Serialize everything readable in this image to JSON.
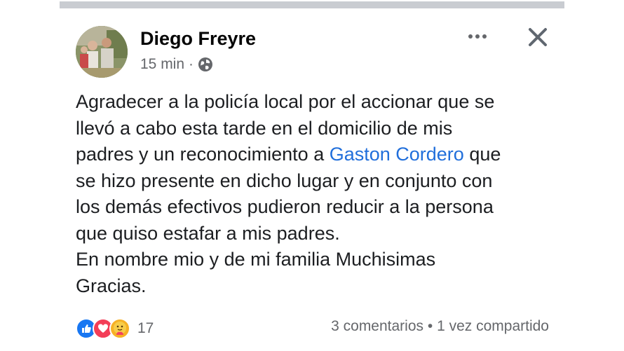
{
  "post": {
    "author": "Diego Freyre",
    "time": "15 min",
    "separator": "·",
    "privacy_icon": "globe-icon",
    "more_icon": "more-options-icon",
    "close_icon": "close-icon",
    "text": {
      "line1": "Agradecer a la policía local por el accionar que se",
      "line2": "llevó a cabo esta tarde en el domicilio de mis",
      "line3_before": "padres y un reconocimiento a ",
      "line3_mention": "Gaston Cordero",
      "line3_after": " que",
      "line4": "se hizo presente en dicho lugar y en conjunto con",
      "line5": "los demás efectivos pudieron reducir a la persona",
      "line6": "que quiso estafar a mis padres.",
      "line7": "En nombre mio y de mi familia Muchisimas",
      "line8": "Gracias."
    },
    "reactions": {
      "icons": [
        "like-icon",
        "love-icon",
        "care-icon"
      ],
      "count": "17"
    },
    "comments_label": "3 comentarios",
    "shares_separator": "•",
    "shares_label": "1 vez compartido"
  },
  "colors": {
    "mention": "#216fdb",
    "secondary_text": "#65676b",
    "like": "#1877f2",
    "love": "#f33e58",
    "care": "#f7b125"
  }
}
